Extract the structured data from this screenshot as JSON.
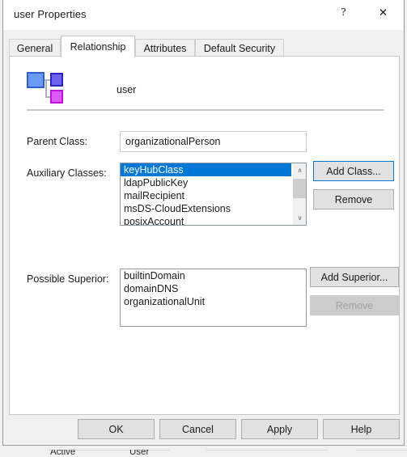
{
  "window": {
    "title": "user Properties",
    "controls": {
      "help": "?",
      "close": "✕"
    }
  },
  "tabs": [
    {
      "label": "General",
      "selected": false
    },
    {
      "label": "Relationship",
      "selected": true
    },
    {
      "label": "Attributes",
      "selected": false
    },
    {
      "label": "Default Security",
      "selected": false
    }
  ],
  "header": {
    "icon": "class-hierarchy-icon",
    "class_name": "user"
  },
  "fields": {
    "parent_class": {
      "label": "Parent Class:",
      "value": "organizationalPerson"
    },
    "auxiliary_classes": {
      "label": "Auxiliary Classes:",
      "items": [
        "keyHubClass",
        "ldapPublicKey",
        "mailRecipient",
        "msDS-CloudExtensions",
        "posixAccount"
      ],
      "selected_index": 0,
      "scrollbar": {
        "up_arrow": "∧",
        "down_arrow": "∨"
      }
    },
    "possible_superior": {
      "label": "Possible Superior:",
      "items": [
        "builtinDomain",
        "domainDNS",
        "organizationalUnit"
      ],
      "selected_index": -1
    }
  },
  "buttons": {
    "add_class": "Add Class...",
    "remove_auxiliary": "Remove",
    "add_superior": "Add Superior...",
    "remove_superior": "Remove",
    "ok": "OK",
    "cancel": "Cancel",
    "apply": "Apply",
    "help": "Help"
  },
  "background_window": {
    "column_one": "Active",
    "column_two": "User"
  },
  "colors": {
    "selection": "#0078d7",
    "focus_border": "#0078d7",
    "dialog_face": "#f0f0f0",
    "button_face": "#e1e1e1",
    "icon_blue": "#4a7fe8",
    "icon_indigo": "#5a4fe0",
    "icon_magenta": "#d63bf0"
  }
}
